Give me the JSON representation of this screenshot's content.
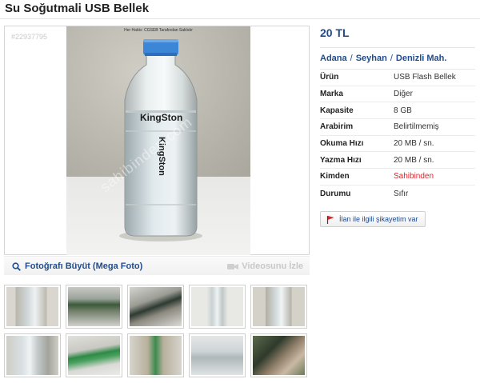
{
  "listing": {
    "title": "Su Soğutmali USB Bellek",
    "photo_id": "#22937795",
    "photo_caption": "Her Hakkı: CGSEB Tarafından Saklıdır",
    "bottle_text_1": "KingSton",
    "bottle_text_2": "KingSton",
    "site_watermark": "sahibinden.com"
  },
  "media": {
    "enlarge_label": "Fotoğrafı Büyüt (Mega Foto)",
    "video_label": "Videosunu İzle",
    "thumbnail_count": 10
  },
  "details": {
    "price": "20 TL",
    "breadcrumb": [
      "Adana",
      "Seyhan",
      "Denizli Mah."
    ],
    "specs": [
      {
        "key": "Ürün",
        "value": "USB Flash Bellek"
      },
      {
        "key": "Marka",
        "value": "Diğer"
      },
      {
        "key": "Kapasite",
        "value": "8 GB"
      },
      {
        "key": "Arabirim",
        "value": "Belirtilmemiş"
      },
      {
        "key": "Okuma Hızı",
        "value": "20 MB / sn."
      },
      {
        "key": "Yazma Hızı",
        "value": "20 MB / sn."
      },
      {
        "key": "Kimden",
        "value": "Sahibinden"
      },
      {
        "key": "Durumu",
        "value": "Sıfır"
      }
    ],
    "report_label": "İlan ile ilgili şikayetim var"
  },
  "colors": {
    "link_blue": "#1f4b8e",
    "seller_red": "#d8262f",
    "report_flag_red": "#d8262f"
  }
}
